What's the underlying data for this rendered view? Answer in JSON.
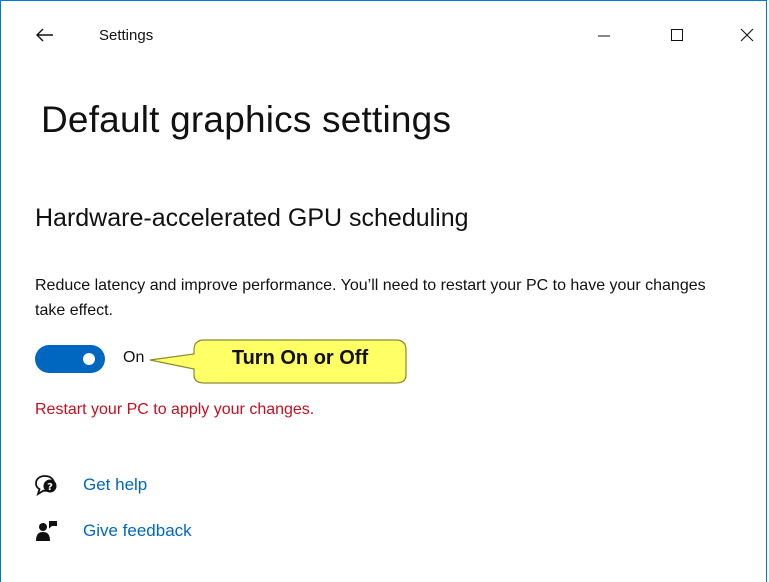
{
  "window": {
    "title": "Settings"
  },
  "page": {
    "title": "Default graphics settings"
  },
  "section": {
    "title": "Hardware-accelerated GPU scheduling",
    "description": "Reduce latency and improve performance. You’ll need to restart your PC to have your changes take effect.",
    "toggle": {
      "state_label": "On",
      "is_on": true
    },
    "callout": "Turn On or Off",
    "warning": "Restart your PC to apply your changes."
  },
  "links": {
    "help": {
      "label": "Get help",
      "icon": "help-chat-icon"
    },
    "feedback": {
      "label": "Give feedback",
      "icon": "feedback-person-icon"
    }
  },
  "colors": {
    "accent": "#0067c0",
    "warning": "#c50f1f",
    "callout_fill": "#ffff66",
    "window_border": "#0078d7"
  }
}
